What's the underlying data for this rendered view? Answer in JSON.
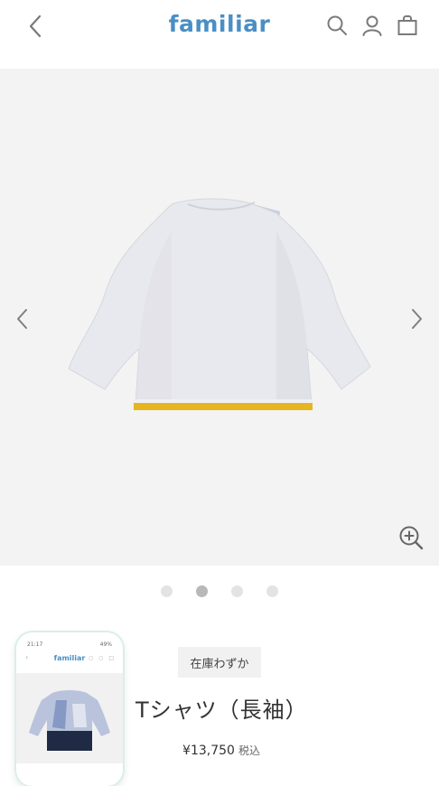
{
  "header": {
    "logo": "familiar",
    "brand_color": "#4a8fc4",
    "icons": [
      "back-icon",
      "search-icon",
      "user-icon",
      "bag-icon"
    ]
  },
  "gallery": {
    "prev_icon": "chevron-left-icon",
    "next_icon": "chevron-right-icon",
    "zoom_icon": "zoom-in-icon",
    "slide_count": 4,
    "active_slide": 2,
    "background": "#f3f3f3"
  },
  "product": {
    "stock_badge": "在庫わずか",
    "title": "Tシャツ（長袖）",
    "price": "¥13,750",
    "tax_label": "税込"
  },
  "phone_preview": {
    "status_time": "21:17",
    "status_right": "49%",
    "logo": "familiar"
  }
}
